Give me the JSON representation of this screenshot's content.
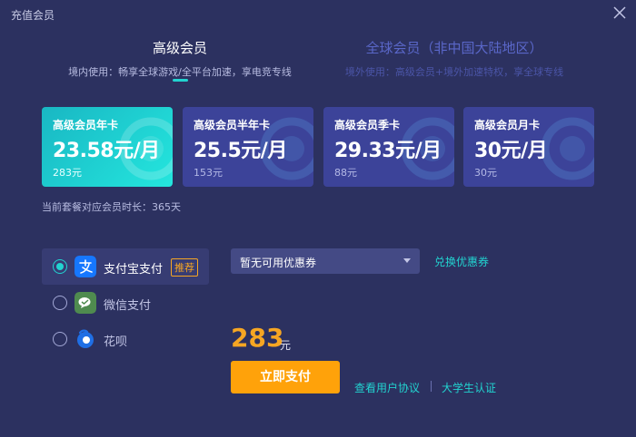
{
  "window": {
    "title": "充值会员"
  },
  "tabs": [
    {
      "name": "高级会员",
      "desc": "境内使用：畅享全球游戏/全平台加速，享电竞专线",
      "active": true
    },
    {
      "name": "全球会员（非中国大陆地区）",
      "desc": "境外使用：高级会员+境外加速特权，享全球专线",
      "active": false
    }
  ],
  "plans": [
    {
      "name": "高级会员年卡",
      "price": "23.58元/月",
      "total": "283元",
      "active": true
    },
    {
      "name": "高级会员半年卡",
      "price": "25.5元/月",
      "total": "153元",
      "active": false
    },
    {
      "name": "高级会员季卡",
      "price": "29.33元/月",
      "total": "88元",
      "active": false
    },
    {
      "name": "高级会员月卡",
      "price": "30元/月",
      "total": "30元",
      "active": false
    }
  ],
  "duration_text": "当前套餐对应会员时长：365天",
  "payment": {
    "options": [
      {
        "label": "支付宝支付",
        "badge": "推荐",
        "icon": "alipay-icon",
        "selected": true
      },
      {
        "label": "微信支付",
        "icon": "wechat-pay-icon",
        "selected": false
      },
      {
        "label": "花呗",
        "icon": "huabei-icon",
        "selected": false
      }
    ]
  },
  "coupon": {
    "selected": "暂无可用优惠券",
    "exchange_label": "兑换优惠券"
  },
  "total": {
    "amount": "283",
    "unit": "元"
  },
  "buttons": {
    "pay_now": "立即支付"
  },
  "links": {
    "user_agreement": "查看用户协议",
    "student_cert": "大学生认证"
  },
  "colors": {
    "background": "#2c3160",
    "accent": "#22d3d0",
    "price": "#f6a623",
    "pay_button": "#ffa20a",
    "card": "#3c4399"
  }
}
